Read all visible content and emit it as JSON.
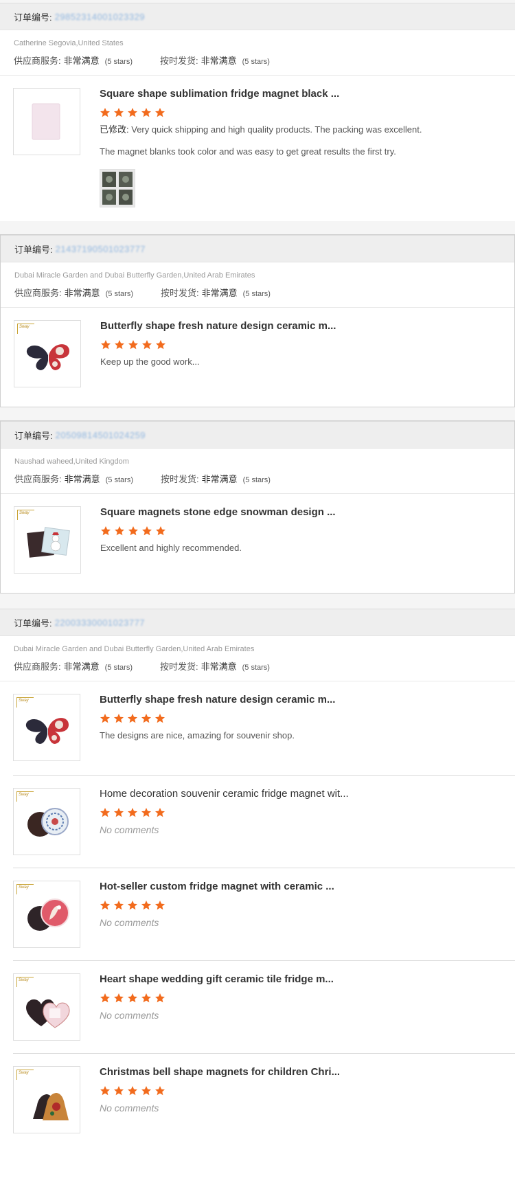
{
  "labels": {
    "order_no": "订单编号:",
    "supplier_service": "供应商服务:",
    "on_time_shipping": "按时发货:",
    "very_satisfied": "非常满意",
    "five_stars": "(5 stars)",
    "modified": "已修改:",
    "no_comments": "No comments"
  },
  "colors": {
    "star": "#f26b1d",
    "order_number": "#8fb6e0",
    "header_bg": "#eeeeee"
  },
  "orders": [
    {
      "order_no": "29852314001023329",
      "customer": "Catherine Segovia,United States",
      "items": [
        {
          "title": "Square shape sublimation fridge magnet black ...",
          "rating": 5,
          "modified_comment": "Very quick shipping and high quality products. The packing was excellent.",
          "comment2": "The magnet blanks took color and was easy to get great results the first try.",
          "image_icon": "white-square-magnet-icon",
          "photo_icon": "customer-photo-icon"
        }
      ]
    },
    {
      "order_no": "21437190501023777",
      "customer": "Dubai Miracle Garden and Dubai Butterfly Garden,United Arab Emirates",
      "items": [
        {
          "title": "Butterfly shape fresh nature design ceramic m...",
          "rating": 5,
          "comment": "Keep up the good work...",
          "image_icon": "butterfly-magnet-icon"
        }
      ]
    },
    {
      "order_no": "20509814501024259",
      "customer": "Naushad waheed,United Kingdom",
      "items": [
        {
          "title": "Square magnets stone edge snowman design ...",
          "rating": 5,
          "comment": "Excellent and highly recommended.",
          "image_icon": "snowman-square-magnet-icon"
        }
      ]
    },
    {
      "order_no": "22003330001023777",
      "customer": "Dubai Miracle Garden and Dubai Butterfly Garden,United Arab Emirates",
      "items": [
        {
          "title": "Butterfly shape fresh nature design ceramic m...",
          "rating": 5,
          "comment": "The designs are nice, amazing for souvenir shop.",
          "image_icon": "butterfly-magnet-icon"
        },
        {
          "title": "Home decoration souvenir ceramic fridge magnet wit...",
          "rating": 5,
          "comment": "",
          "image_icon": "round-mandala-magnet-icon"
        },
        {
          "title": "Hot-seller custom fridge magnet with ceramic ...",
          "rating": 5,
          "comment": "",
          "image_icon": "round-floral-magnet-icon"
        },
        {
          "title": "Heart shape wedding gift ceramic tile fridge m...",
          "rating": 5,
          "comment": "",
          "image_icon": "heart-magnet-icon"
        },
        {
          "title": "Christmas bell shape magnets for children Chri...",
          "rating": 5,
          "comment": "",
          "image_icon": "bell-magnet-icon"
        }
      ]
    }
  ]
}
